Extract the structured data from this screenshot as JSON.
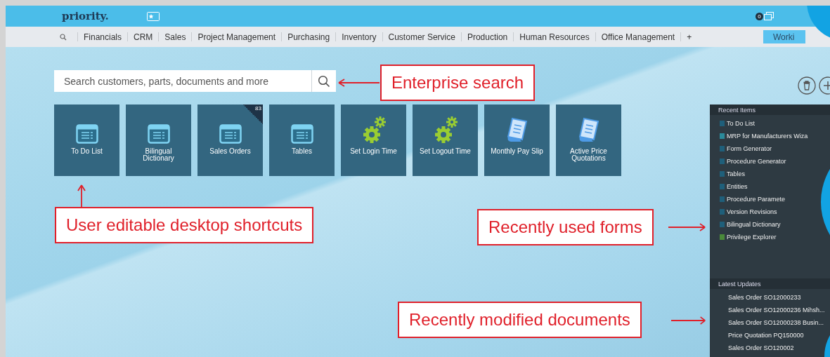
{
  "header": {
    "logo": "priority.",
    "notification_count": "0",
    "workspace_button": "Worki"
  },
  "nav": {
    "items": [
      "Financials",
      "CRM",
      "Sales",
      "Project Management",
      "Purchasing",
      "Inventory",
      "Customer Service",
      "Production",
      "Human Resources",
      "Office Management"
    ],
    "add": "+"
  },
  "search": {
    "placeholder": "Search customers, parts, documents and more"
  },
  "shortcuts": [
    {
      "label": "To Do List",
      "kind": "form"
    },
    {
      "label": "Bilingual Dictionary",
      "kind": "form"
    },
    {
      "label": "Sales Orders",
      "kind": "form",
      "badge": "83"
    },
    {
      "label": "Tables",
      "kind": "form"
    },
    {
      "label": "Set Login Time",
      "kind": "procedure"
    },
    {
      "label": "Set Logout Time",
      "kind": "procedure"
    },
    {
      "label": "Monthly Pay Slip",
      "kind": "report"
    },
    {
      "label": "Active Price Quotations",
      "kind": "report"
    }
  ],
  "recent_items": {
    "title": "Recent Items",
    "items": [
      {
        "label": "To Do List",
        "color": "#1f5f7a"
      },
      {
        "label": "MRP for Manufacturers Wiza",
        "color": "#2a8a9a"
      },
      {
        "label": "Form Generator",
        "color": "#1f5f7a"
      },
      {
        "label": "Procedure Generator",
        "color": "#1f5f7a"
      },
      {
        "label": "Tables",
        "color": "#1f5f7a"
      },
      {
        "label": "Entities",
        "color": "#1f5f7a"
      },
      {
        "label": "Procedure Paramete",
        "color": "#1f5f7a"
      },
      {
        "label": "Version Revisions",
        "color": "#1f5f7a"
      },
      {
        "label": "Bilingual Dictionary",
        "color": "#1f5f7a"
      },
      {
        "label": "Privilege Explorer",
        "color": "#4a8a3a"
      }
    ]
  },
  "latest_updates": {
    "title": "Latest Updates",
    "items": [
      "Sales Order SO12000233",
      "Sales Order SO12000236 Mihsh...",
      "Sales Order SO12000238 Busin...",
      "Price Quotation PQ150000",
      "Sales Order SO120002"
    ]
  },
  "annotations": [
    {
      "text": "Enterprise search",
      "kind": "left"
    },
    {
      "text": "User editable desktop shortcuts",
      "kind": "up"
    },
    {
      "text": "Recently used forms",
      "kind": "right"
    },
    {
      "text": "Recently modified documents",
      "kind": "right"
    }
  ]
}
